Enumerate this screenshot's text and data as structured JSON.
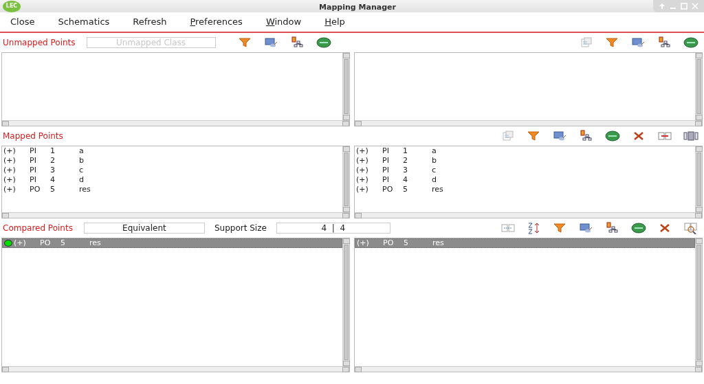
{
  "window": {
    "logo": "LEC",
    "title": "Mapping Manager"
  },
  "menu": [
    {
      "label": "Close",
      "mnemonic": false
    },
    {
      "label": "Schematics",
      "mnemonic": false
    },
    {
      "label": "Refresh",
      "mnemonic": false
    },
    {
      "label": "Preferences",
      "mnemonic": true
    },
    {
      "label": "Window",
      "mnemonic": true
    },
    {
      "label": "Help",
      "mnemonic": true
    }
  ],
  "unmapped": {
    "title": "Unmapped Points",
    "class_field": {
      "placeholder": "Unmapped Class"
    },
    "left_tools": [
      {
        "kind": "filter"
      },
      {
        "kind": "display"
      },
      {
        "kind": "hierarchy"
      },
      {
        "kind": "class"
      }
    ],
    "right_tools": [
      {
        "kind": "report"
      },
      {
        "kind": "filter"
      },
      {
        "kind": "display"
      },
      {
        "kind": "hierarchy"
      },
      {
        "kind": "class"
      }
    ]
  },
  "mapped": {
    "title": "Mapped Points",
    "tools": [
      {
        "kind": "report"
      },
      {
        "kind": "filter"
      },
      {
        "kind": "display"
      },
      {
        "kind": "hierarchy"
      },
      {
        "kind": "class"
      },
      {
        "kind": "delete"
      },
      {
        "kind": "compare"
      },
      {
        "kind": "columns"
      }
    ],
    "left_rows": [
      {
        "cells": [
          "(+)",
          "PI",
          "1",
          "a"
        ],
        "selected": false
      },
      {
        "cells": [
          "(+)",
          "PI",
          "2",
          "b"
        ],
        "selected": false
      },
      {
        "cells": [
          "(+)",
          "PI",
          "3",
          "c"
        ],
        "selected": false
      },
      {
        "cells": [
          "(+)",
          "PI",
          "4",
          "d"
        ],
        "selected": false
      },
      {
        "cells": [
          "(+)",
          "PO",
          "5",
          "res"
        ],
        "selected": false
      }
    ],
    "right_rows": [
      {
        "cells": [
          "(+)",
          "PI",
          "1",
          "a"
        ],
        "selected": false
      },
      {
        "cells": [
          "(+)",
          "PI",
          "2",
          "b"
        ],
        "selected": false
      },
      {
        "cells": [
          "(+)",
          "PI",
          "3",
          "c"
        ],
        "selected": false
      },
      {
        "cells": [
          "(+)",
          "PI",
          "4",
          "d"
        ],
        "selected": false
      },
      {
        "cells": [
          "(+)",
          "PO",
          "5",
          "res"
        ],
        "selected": false
      }
    ]
  },
  "compared": {
    "title": "Compared Points",
    "result_field": {
      "value": "Equivalent"
    },
    "support_label": "Support Size",
    "support_field": {
      "value": "4  |  4"
    },
    "tools": [
      {
        "kind": "matching"
      },
      {
        "kind": "sort"
      },
      {
        "kind": "filter"
      },
      {
        "kind": "display"
      },
      {
        "kind": "hierarchy"
      },
      {
        "kind": "class"
      },
      {
        "kind": "delete"
      },
      {
        "kind": "zoom"
      }
    ],
    "left_rows": [
      {
        "cells": [
          "(+)",
          "PO",
          "5",
          "res"
        ],
        "selected": true,
        "color": "#00dd00"
      }
    ],
    "right_rows": [
      {
        "cells": [
          "(+)",
          "PO",
          "5",
          "res"
        ],
        "selected": true
      }
    ]
  }
}
